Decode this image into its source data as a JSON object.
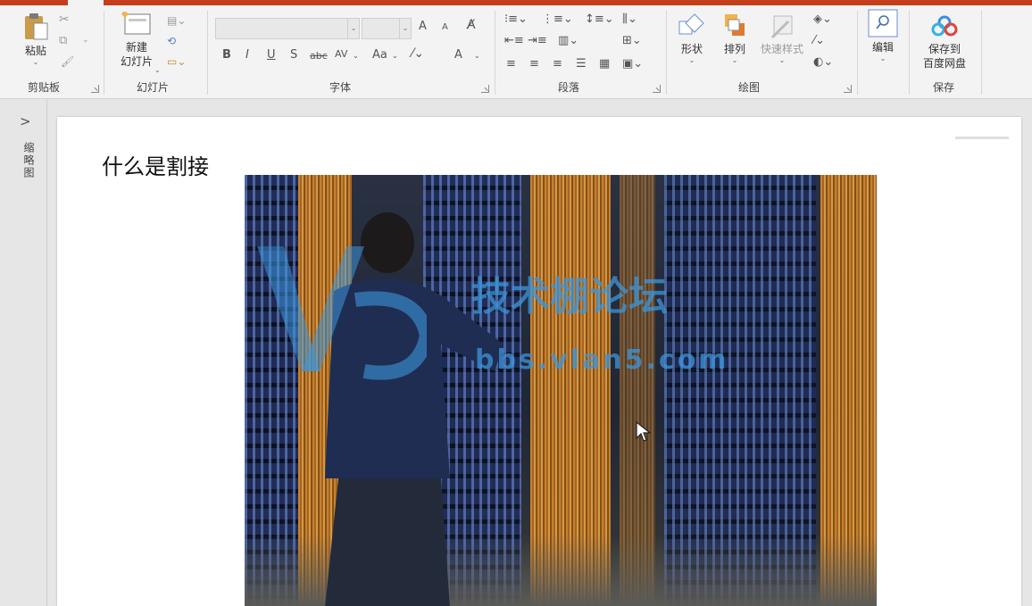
{
  "ribbon": {
    "clipboard": {
      "paste_label": "粘贴",
      "group_label": "剪贴板"
    },
    "slides": {
      "new_slide_line1": "新建",
      "new_slide_line2": "幻灯片",
      "group_label": "幻灯片"
    },
    "font": {
      "bold": "B",
      "italic": "I",
      "underline": "U",
      "strike": "S",
      "abc": "abc",
      "spacing": "AV",
      "case": "Aa",
      "color": "A",
      "grow": "A",
      "shrink": "A",
      "group_label": "字体"
    },
    "paragraph": {
      "group_label": "段落"
    },
    "drawing": {
      "shapes_label": "形状",
      "arrange_label": "排列",
      "quick_styles_label": "快速样式",
      "group_label": "绘图"
    },
    "editing": {
      "edit_label": "编辑"
    },
    "save": {
      "save_line1": "保存到",
      "save_line2": "百度网盘",
      "group_label": "保存"
    }
  },
  "thumbnail_pane": {
    "collapse_glyph": ">",
    "label": "缩略图"
  },
  "slide": {
    "title": "什么是割接",
    "watermark_text": "技术棚论坛",
    "watermark_url": "bbs.vlan5.com"
  },
  "colors": {
    "accent": "#c43e1c",
    "ribbon_bg": "#f3f3f3",
    "watermark": "#3c96dc",
    "cable": "#d98a2a"
  }
}
